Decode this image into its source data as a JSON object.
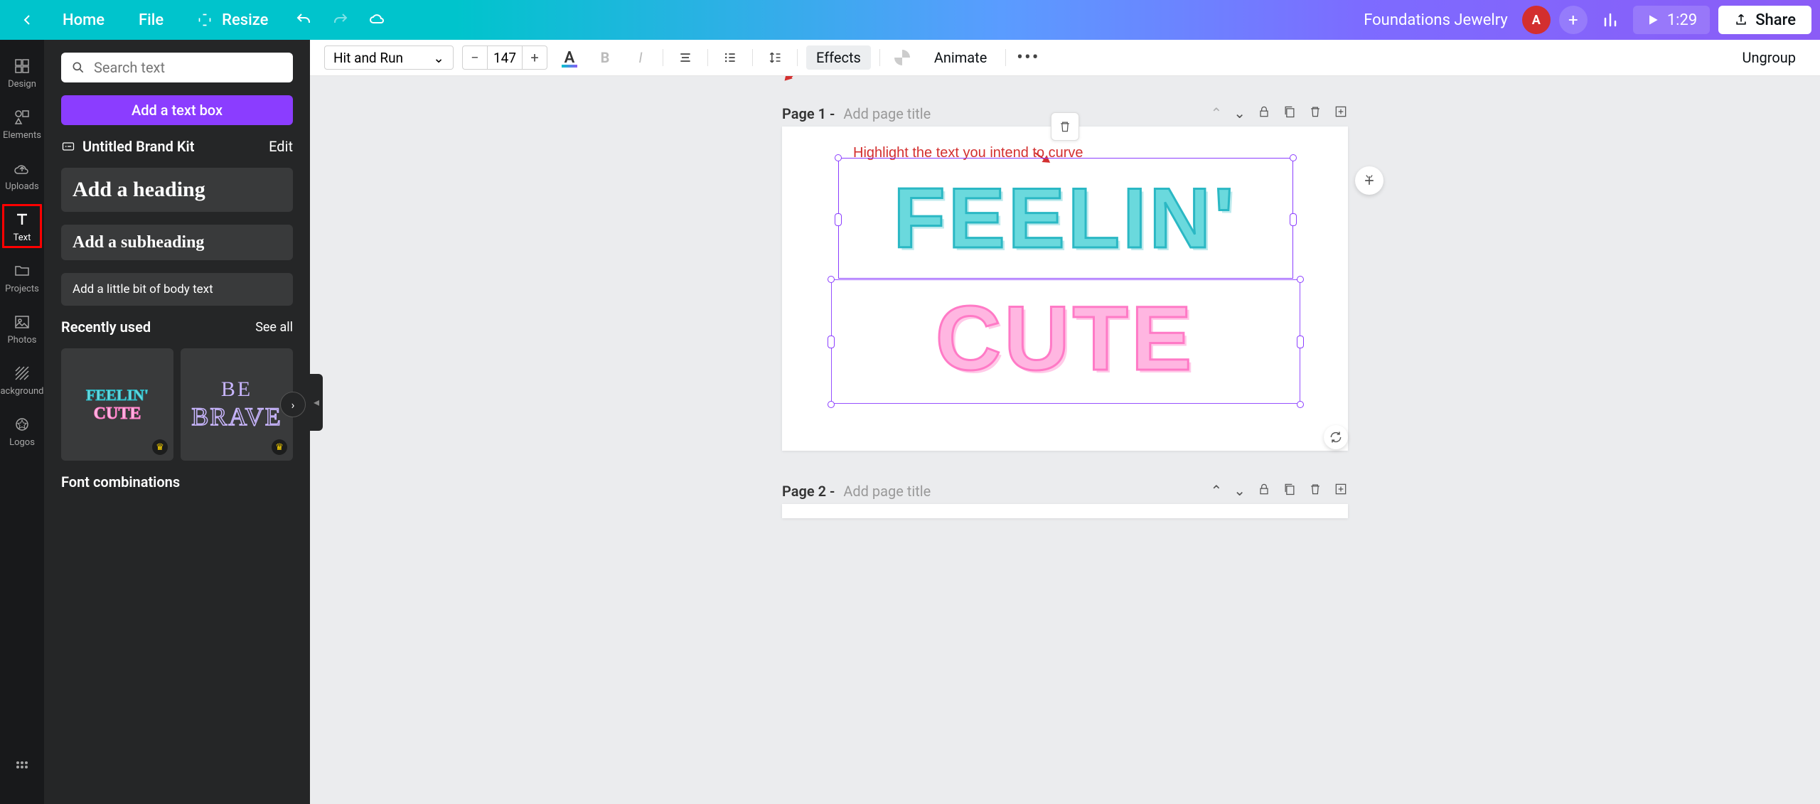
{
  "topbar": {
    "home": "Home",
    "file": "File",
    "resize": "Resize",
    "doc_title": "Foundations Jewelry",
    "avatar_letter": "A",
    "duration": "1:29",
    "share": "Share"
  },
  "rail": {
    "design": "Design",
    "elements": "Elements",
    "uploads": "Uploads",
    "text": "Text",
    "projects": "Projects",
    "photos": "Photos",
    "background": "ackground",
    "logos": "Logos"
  },
  "panel": {
    "search_placeholder": "Search text",
    "add_text_box": "Add a text box",
    "brand_kit": "Untitled Brand Kit",
    "edit": "Edit",
    "heading": "Add a heading",
    "subheading": "Add a subheading",
    "body": "Add a little bit of body text",
    "recently_used": "Recently used",
    "see_all": "See all",
    "font_combinations": "Font combinations",
    "recent": {
      "card1_line1": "FEELIN'",
      "card1_line2": "CUTE",
      "card2_line1": "BE",
      "card2_line2": "BRAVE"
    }
  },
  "ctx": {
    "font": "Hit and Run",
    "size": "147",
    "effects": "Effects",
    "animate": "Animate",
    "ungroup": "Ungroup"
  },
  "pages": {
    "p1_label": "Page 1 -",
    "p1_placeholder": "Add page title",
    "p2_label": "Page 2 -",
    "p2_placeholder": "Add page title"
  },
  "canvas": {
    "annot": "Highlight the text you intend to curve",
    "line1": "FEELIN'",
    "line2": "CUTE"
  },
  "colors": {
    "accent": "#8b3dff",
    "teal": "#00c4cc",
    "annot_red": "#d32f2f"
  }
}
